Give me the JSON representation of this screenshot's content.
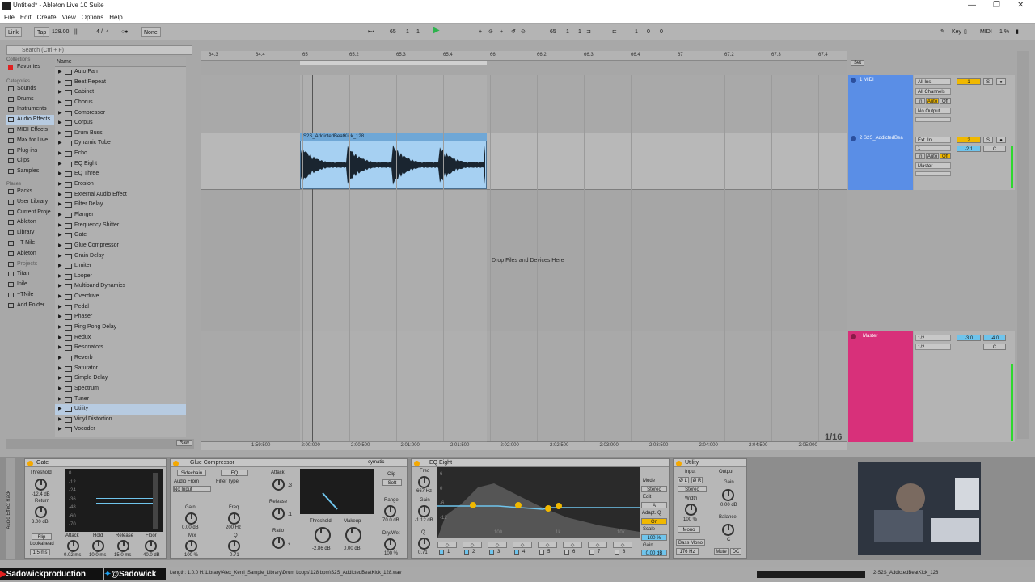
{
  "window": {
    "title": "Untitled* - Ableton Live 10 Suite",
    "min": "—",
    "max": "❐",
    "close": "✕"
  },
  "menu": [
    "File",
    "Edit",
    "Create",
    "View",
    "Options",
    "Help"
  ],
  "control": {
    "link": "Link",
    "tap": "Tap",
    "tempo": "128.00",
    "sig_num": "4",
    "sig_den": "4",
    "metro": "○●",
    "quant": "None",
    "pos1": "65",
    "pos2": "1",
    "pos3": "1",
    "loop1": "65",
    "loop2": "1",
    "loop3": "1",
    "len1": "1",
    "len2": "0",
    "len3": "0",
    "key": "Key",
    "midi": "MIDI",
    "cpu": "1 %",
    "accent": "#f0b800"
  },
  "search": {
    "placeholder": "Search (Ctrl + F)"
  },
  "sidebar": {
    "collections_header": "Collections",
    "favorites": "Favorites",
    "categories_header": "Categories",
    "categories": [
      "Sounds",
      "Drums",
      "Instruments",
      "Audio Effects",
      "MIDI Effects",
      "Max for Live",
      "Plug-ins",
      "Clips",
      "Samples"
    ],
    "places_header": "Places",
    "places": [
      "Packs",
      "User Library",
      "Current Proje",
      "Ableton",
      "Library",
      "~T Nile",
      "Ableton",
      "Projects",
      "Titan",
      "Inile",
      "~TNile",
      "Add Folder..."
    ]
  },
  "list": {
    "header": "Name",
    "items": [
      "Auto Pan",
      "Beat Repeat",
      "Cabinet",
      "Chorus",
      "Compressor",
      "Corpus",
      "Drum Buss",
      "Dynamic Tube",
      "Echo",
      "EQ Eight",
      "EQ Three",
      "Erosion",
      "External Audio Effect",
      "Filter Delay",
      "Flanger",
      "Frequency Shifter",
      "Gate",
      "Glue Compressor",
      "Grain Delay",
      "Limiter",
      "Looper",
      "Multiband Dynamics",
      "Overdrive",
      "Pedal",
      "Phaser",
      "Ping Pong Delay",
      "Redux",
      "Resonators",
      "Reverb",
      "Saturator",
      "Simple Delay",
      "Spectrum",
      "Tuner",
      "Utility",
      "Vinyl Distortion",
      "Vocoder"
    ]
  },
  "browser_raw": "Raw",
  "ruler": [
    "64.3",
    "64.4",
    "65",
    "65.2",
    "65.3",
    "65.4",
    "66",
    "66.2",
    "66.3",
    "66.4",
    "67",
    "67.2",
    "67.3",
    "67.4"
  ],
  "set_btn": "Set",
  "clip": {
    "name": "S2S_AddictedBeatKick_128"
  },
  "drop_text": "Drop Files and Devices Here",
  "quantization": "1/16",
  "tracks": [
    {
      "name": "1 MIDI",
      "color": "#5a8ee6",
      "in1": "All Ins",
      "in2": "All Channels",
      "mon_in": "In",
      "mon_auto": "Auto",
      "mon_off": "Off",
      "out": "No Output",
      "num": "1",
      "solo": "S",
      "arm": "●"
    },
    {
      "name": "2 S2S_AddictedBea",
      "color": "#5a8ee6",
      "in1": "Ext. In",
      "in2": "1",
      "mon_in": "In",
      "mon_auto": "Auto",
      "mon_off": "Off",
      "out": "Master",
      "num": "2",
      "vol": "-2.1",
      "pan": "C",
      "solo": "S",
      "arm": "●"
    },
    {
      "name": "Master",
      "color": "#d8307a",
      "in1": "1/2",
      "in2": "1/2",
      "vol": "-3.0",
      "vol2": "-4.0",
      "pan": "C"
    }
  ],
  "timeline": [
    "1:59:500",
    "2:00:000",
    "2:00:500",
    "2:01:000",
    "2:01:500",
    "2:02:000",
    "2:02:500",
    "2:03:000",
    "2:03:500",
    "2:04:000",
    "2:04:500",
    "2:05:000"
  ],
  "devices": {
    "gate": {
      "title": "Gate",
      "threshold": "Threshold",
      "threshold_val": "-12.4 dB",
      "return": "Return",
      "return_val": "3.00 dB",
      "flip": "Flip",
      "lookahead": "Lookahead",
      "look_val": "1.5 ms",
      "attack": "Attack",
      "attack_val": "0.02 ms",
      "hold": "Hold",
      "hold_val": "10.0 ms",
      "release": "Release",
      "release_val": "15.0 ms",
      "floor": "Floor",
      "floor_val": "-40.0 dB",
      "scale": [
        "0",
        "-12",
        "-24",
        "-36",
        "-48",
        "-60",
        "-70"
      ],
      "rack": "Audio Effect Rack"
    },
    "glue": {
      "title": "Glue Compressor",
      "sidechain": "Sidechain",
      "eq": "EQ",
      "audio_from": "Audio From",
      "no_input": "No Input",
      "filter_type": "Filter Type",
      "gain": "Gain",
      "gain_val": "0.00 dB",
      "freq": "Freq",
      "freq_val": "200 Hz",
      "mix": "Mix",
      "mix_val": "100 %",
      "q": "Q",
      "q_val": "0.71",
      "attack": "Attack",
      "attack_val": ".3",
      "release": "Release",
      "release_val": ".1",
      "ratio": "Ratio",
      "ratio_val": "2",
      "threshold": "Threshold",
      "threshold_val": "-2.86 dB",
      "makeup": "Makeup",
      "makeup_val": "0.00 dB",
      "soft": "Soft",
      "clip": "Clip",
      "range": "Range",
      "range_val": "70.0 dB",
      "drywet": "Dry/Wet",
      "drywet_val": "100 %",
      "cymatic": "cymatic"
    },
    "eq": {
      "title": "EQ Eight",
      "freq": "Freq",
      "freq_val": "667 Hz",
      "gain": "Gain",
      "gain_val": "-1.12 dB",
      "q": "Q",
      "q_val": "0.71",
      "mode": "Mode",
      "mode_val": "Stereo",
      "edit": "Edit",
      "a": "A",
      "adapt_q": "Adapt. Q",
      "on": "On",
      "scale": "Scale",
      "scale_val": "100 %",
      "gain2": "Gain",
      "gain2_val": "0.00 dB",
      "bands": [
        "1",
        "2",
        "3",
        "4",
        "5",
        "6",
        "7",
        "8"
      ],
      "grid": [
        "6",
        "0",
        "-6",
        "-12"
      ],
      "freqs": [
        "100",
        "1k",
        "10k"
      ]
    },
    "utility": {
      "title": "Utility",
      "input": "Input",
      "output": "Output",
      "phase_l": "Ø L",
      "phase_r": "Ø R",
      "stereo": "Stereo",
      "width": "Width",
      "width_val": "100 %",
      "mono": "Mono",
      "bass_mono": "Bass Mono",
      "bass_val": "176 Hz",
      "gain": "Gain",
      "gain_val": "0.00 dB",
      "balance": "Balance",
      "balance_val": "C",
      "mute": "Mute",
      "dc": "DC"
    }
  },
  "status": {
    "text": "Length: 1.0.0 H:\\Library\\Alex_Kenji_Sample_Library\\Drum Loops\\128 bpm\\S2S_AddictedBeatKick_128.wav",
    "right": "2-S2S_AddictedBeatKick_128"
  },
  "overlays": {
    "youtube": "Sadowickproduction",
    "twitter": "@Sadowick"
  }
}
